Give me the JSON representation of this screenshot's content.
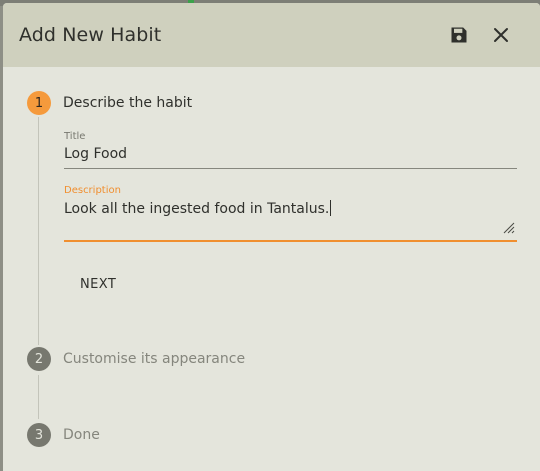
{
  "dialog": {
    "title": "Add New Habit",
    "save_icon": "floppy-save-icon",
    "close_icon": "close-icon"
  },
  "steps": [
    {
      "number": "1",
      "label": "Describe the habit",
      "state": "active"
    },
    {
      "number": "2",
      "label": "Customise its appearance",
      "state": "inactive"
    },
    {
      "number": "3",
      "label": "Done",
      "state": "inactive"
    }
  ],
  "form": {
    "title_label": "Title",
    "title_value": "Log Food",
    "description_label": "Description",
    "description_value": "Look all the ingested food in Tantalus."
  },
  "next_label": "NEXT",
  "colors": {
    "accent": "#f59a3c",
    "header_bg": "#cfd0be",
    "dialog_bg": "#e4e5dc"
  }
}
